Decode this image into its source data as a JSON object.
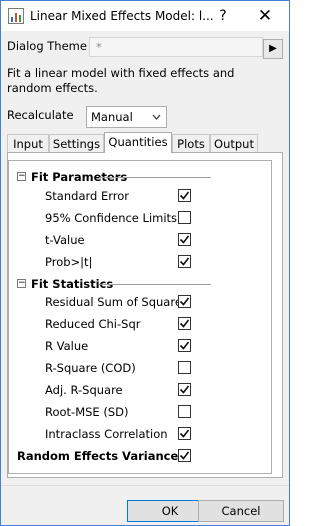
{
  "window": {
    "title": "Linear Mixed Effects Model: l...",
    "help_glyph": "?",
    "close_glyph": "✕"
  },
  "dialog_theme": {
    "label": "Dialog Theme",
    "value": "*",
    "arrow_glyph": "▶"
  },
  "description": "Fit a linear model with fixed effects and random effects.",
  "recalculate": {
    "label": "Recalculate",
    "value": "Manual"
  },
  "tabs": [
    {
      "label": "Input",
      "active": false
    },
    {
      "label": "Settings",
      "active": false
    },
    {
      "label": "Quantities",
      "active": true
    },
    {
      "label": "Plots",
      "active": false
    },
    {
      "label": "Output",
      "active": false
    }
  ],
  "tree": {
    "fit_parameters": {
      "label": "Fit Parameters",
      "expander": "−",
      "items": [
        {
          "label": "Standard Error",
          "checked": true
        },
        {
          "label": "95% Confidence Limits",
          "checked": false
        },
        {
          "label": "t-Value",
          "checked": true
        },
        {
          "label": "Prob>|t|",
          "checked": true
        }
      ]
    },
    "fit_statistics": {
      "label": "Fit Statistics",
      "expander": "−",
      "items": [
        {
          "label": "Residual Sum of Squares",
          "checked": true
        },
        {
          "label": "Reduced Chi-Sqr",
          "checked": true
        },
        {
          "label": "R Value",
          "checked": true
        },
        {
          "label": "R-Square (COD)",
          "checked": false
        },
        {
          "label": "Adj. R-Square",
          "checked": true
        },
        {
          "label": "Root-MSE (SD)",
          "checked": false
        },
        {
          "label": "Intraclass Correlation",
          "checked": true
        }
      ]
    },
    "random_effects_variance": {
      "label": "Random Effects Variance",
      "checked": true
    }
  },
  "buttons": {
    "ok": "OK",
    "cancel": "Cancel"
  }
}
